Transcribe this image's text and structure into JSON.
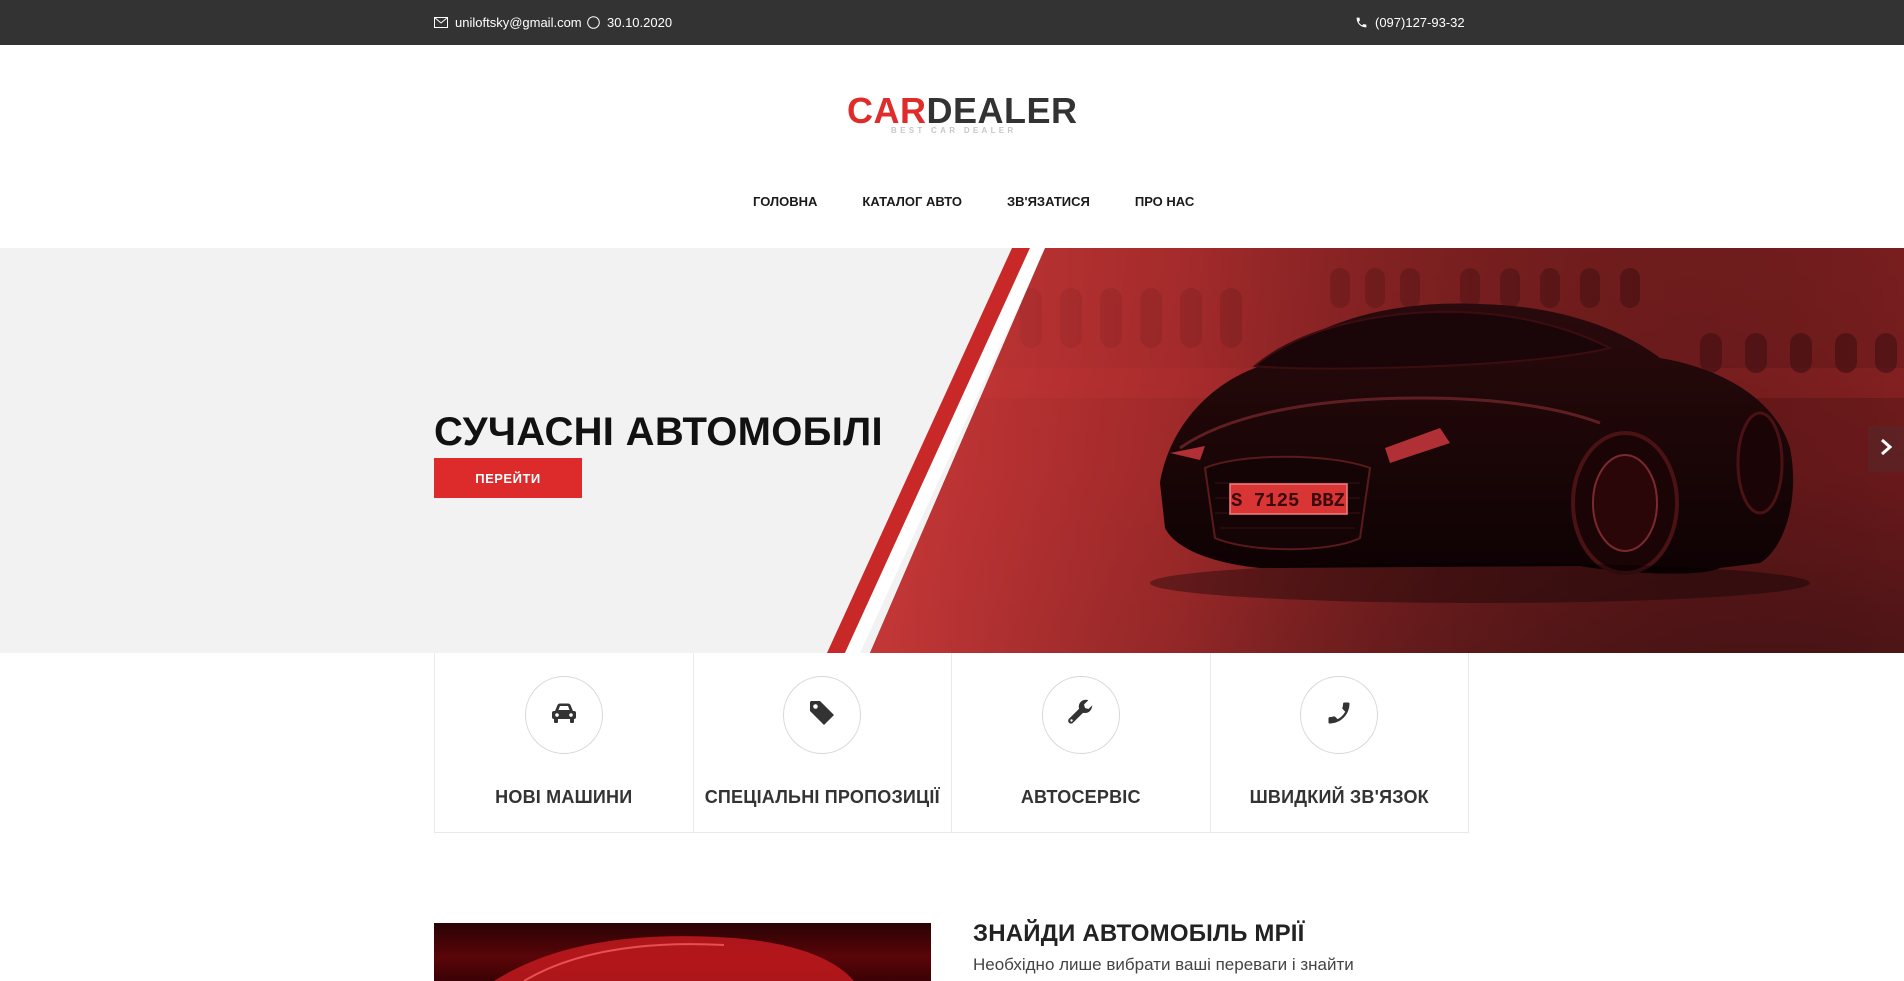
{
  "topbar": {
    "email": "uniloftsky@gmail.com",
    "date": "30.10.2020",
    "phone": "(097)127-93-32"
  },
  "logo": {
    "part1": "CAR",
    "part2": "DEALER",
    "tagline": "BEST CAR DEALER"
  },
  "nav": {
    "items": [
      {
        "label": "ГОЛОВНА"
      },
      {
        "label": "КАТАЛОГ АВТО"
      },
      {
        "label": "ЗВ'ЯЗАТИСЯ"
      },
      {
        "label": "ПРО НАС"
      }
    ]
  },
  "hero": {
    "title": "СУЧАСНІ АВТОМОБІЛІ",
    "button_label": "ПЕРЕЙТИ",
    "plate": "S 7125 BBZ"
  },
  "features": [
    {
      "label": "НОВІ МАШИНИ",
      "icon": "car-icon"
    },
    {
      "label": "СПЕЦІАЛЬНІ ПРОПОЗИЦІЇ",
      "icon": "tag-icon"
    },
    {
      "label": "АВТОСЕРВІС",
      "icon": "wrench-icon"
    },
    {
      "label": "ШВИДКИЙ ЗВ'ЯЗОК",
      "icon": "phone-icon"
    }
  ],
  "dream": {
    "title": "ЗНАЙДИ АВТОМОБІЛЬ МРІЇ",
    "text": "Необхідно лише вибрати ваші переваги і знайти"
  },
  "colors": {
    "accent": "#dd2b2b",
    "topbar": "#333333",
    "hero_bg": "#f2f2f2"
  }
}
